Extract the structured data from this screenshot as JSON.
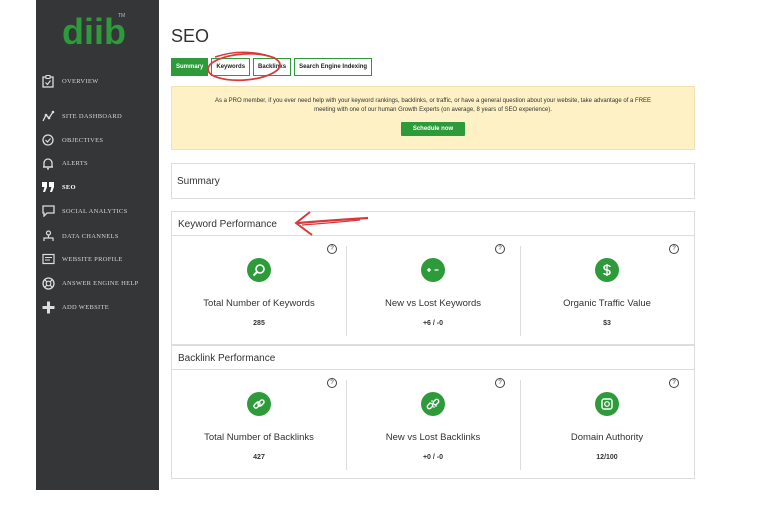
{
  "logo": {
    "text": "diib",
    "tm": "TM"
  },
  "sidebar": {
    "items": [
      {
        "label": "OVERVIEW",
        "icon": "clipboard-icon"
      },
      {
        "label": "SITE DASHBOARD",
        "icon": "chart-line-icon"
      },
      {
        "label": "OBJECTIVES",
        "icon": "check-circle-icon"
      },
      {
        "label": "ALERTS",
        "icon": "bell-icon"
      },
      {
        "label": "SEO",
        "icon": "quote-icon",
        "active": true
      },
      {
        "label": "SOCIAL ANALYTICS",
        "icon": "chat-icon"
      },
      {
        "label": "DATA CHANNELS",
        "icon": "data-channels-icon"
      },
      {
        "label": "WEBSITE PROFILE",
        "icon": "profile-icon"
      },
      {
        "label": "ANSWER ENGINE HELP",
        "icon": "lifebuoy-icon"
      },
      {
        "label": "ADD WEBSITE",
        "icon": "plus-icon"
      }
    ]
  },
  "page": {
    "title": "SEO"
  },
  "tabs": [
    {
      "label": "Summary",
      "active": true
    },
    {
      "label": "Keywords"
    },
    {
      "label": "Backlinks"
    },
    {
      "label": "Search Engine Indexing"
    }
  ],
  "banner": {
    "text": "As a PRO member, if you ever need help with your keyword rankings, backlinks, or traffic, or have a general question about your website, take advantage of a FREE meeting with one of our human Growth Experts (on average, 8 years of SEO experience).",
    "button": "Schedule now"
  },
  "summary": {
    "title": "Summary"
  },
  "keyword_performance": {
    "title": "Keyword Performance",
    "metrics": [
      {
        "label": "Total Number of Keywords",
        "value": "285",
        "icon": "search-icon"
      },
      {
        "label": "New vs Lost Keywords",
        "value": "+6 / -0",
        "icon": "plus-minus-icon"
      },
      {
        "label": "Organic Traffic Value",
        "value": "$3",
        "icon": "dollar-icon"
      }
    ]
  },
  "backlink_performance": {
    "title": "Backlink Performance",
    "metrics": [
      {
        "label": "Total Number of Backlinks",
        "value": "427",
        "icon": "link-icon"
      },
      {
        "label": "New vs Lost Backlinks",
        "value": "+0 / -0",
        "icon": "broken-link-icon"
      },
      {
        "label": "Domain Authority",
        "value": "12/100",
        "icon": "authority-icon"
      }
    ]
  },
  "help_glyph": "?",
  "colors": {
    "sidebar": "#343638",
    "accent": "#2d9b3a",
    "banner": "#fdf1c5",
    "annotation": "#d9393b"
  }
}
